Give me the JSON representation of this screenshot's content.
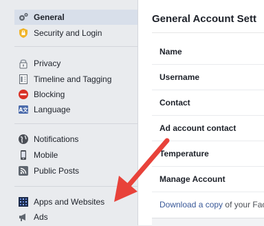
{
  "sidebar": {
    "items": [
      {
        "label": "General",
        "icon": "gear-icon",
        "active": true
      },
      {
        "label": "Security and Login",
        "icon": "shield-icon"
      },
      {
        "label": "Privacy",
        "icon": "lock-icon"
      },
      {
        "label": "Timeline and Tagging",
        "icon": "timeline-icon"
      },
      {
        "label": "Blocking",
        "icon": "blocked-icon"
      },
      {
        "label": "Language",
        "icon": "language-icon"
      },
      {
        "label": "Notifications",
        "icon": "globe-icon"
      },
      {
        "label": "Mobile",
        "icon": "mobile-icon"
      },
      {
        "label": "Public Posts",
        "icon": "rss-icon"
      },
      {
        "label": "Apps and Websites",
        "icon": "apps-icon"
      },
      {
        "label": "Ads",
        "icon": "ads-icon"
      }
    ]
  },
  "main": {
    "title": "General Account Sett",
    "rows": [
      {
        "label": "Name"
      },
      {
        "label": "Username"
      },
      {
        "label": "Contact"
      },
      {
        "label": "Ad account contact"
      },
      {
        "label": "Temperature"
      },
      {
        "label": "Manage Account"
      }
    ],
    "download": {
      "link_text": "Download a copy",
      "suffix": " of your Fac"
    }
  },
  "colors": {
    "sidebar_bg": "#e9ebee",
    "active_bg": "#d8dfea",
    "link": "#385898",
    "arrow": "#e8423a"
  }
}
